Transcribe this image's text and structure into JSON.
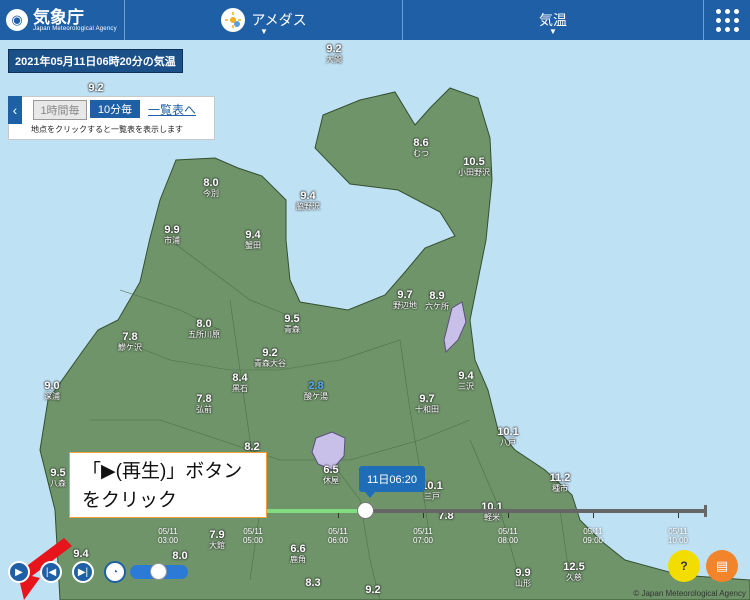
{
  "header": {
    "logo_jp": "気象庁",
    "logo_en": "Japan Meteorological Agency",
    "menu_amedas": "アメダス",
    "menu_element": "気温"
  },
  "title": "2021年05月11日06時20分の気温",
  "controls": {
    "btn_1h": "1時間毎",
    "btn_10min": "10分毎",
    "link_list": "一覧表へ",
    "note": "地点をクリックすると一覧表を表示します"
  },
  "stations": [
    {
      "value": "9.2",
      "name": "大間"
    },
    {
      "value": "8.6",
      "name": "むつ"
    },
    {
      "value": "10.5",
      "name": "小田野沢"
    },
    {
      "value": "8.0",
      "name": "今別"
    },
    {
      "value": "9.4",
      "name": "脇野沢"
    },
    {
      "value": "9.9",
      "name": "市浦"
    },
    {
      "value": "9.4",
      "name": "蟹田"
    },
    {
      "value": "9.7",
      "name": "野辺地"
    },
    {
      "value": "8.9",
      "name": "六ケ所"
    },
    {
      "value": "8.0",
      "name": "五所川原"
    },
    {
      "value": "9.5",
      "name": "青森"
    },
    {
      "value": "7.8",
      "name": "鰺ケ沢"
    },
    {
      "value": "9.2",
      "name": "青森大谷"
    },
    {
      "value": "9.0",
      "name": "深浦"
    },
    {
      "value": "8.4",
      "name": "黒石"
    },
    {
      "value": "2.8",
      "name": "酸ケ湯"
    },
    {
      "value": "9.4",
      "name": "三沢"
    },
    {
      "value": "7.8",
      "name": "弘前"
    },
    {
      "value": "9.7",
      "name": "十和田"
    },
    {
      "value": "10.1",
      "name": "八戸"
    },
    {
      "value": "6.5",
      "name": "休屋"
    },
    {
      "value": "9.5",
      "name": "八森"
    },
    {
      "value": "10.1",
      "name": "三戸"
    },
    {
      "value": "11.2",
      "name": "種市"
    },
    {
      "value": "7.8",
      "name": ""
    },
    {
      "value": "10.1",
      "name": "軽米"
    },
    {
      "value": "7.9",
      "name": "大館"
    },
    {
      "value": "9.4",
      "name": ""
    },
    {
      "value": "8.0",
      "name": ""
    },
    {
      "value": "6.6",
      "name": "鹿角"
    },
    {
      "value": "9.9",
      "name": "山形"
    },
    {
      "value": "12.5",
      "name": "久慈"
    },
    {
      "value": "8.3",
      "name": ""
    },
    {
      "value": "9.2",
      "name": ""
    },
    {
      "value": "8.2",
      "name": ""
    },
    {
      "value": "9.2",
      "name": ""
    }
  ],
  "timeline": {
    "current_label": "11日06:20",
    "ticks": [
      {
        "date": "05/11",
        "time": "03:00"
      },
      {
        "date": "05/11",
        "time": "05:00"
      },
      {
        "date": "05/11",
        "time": "06:00"
      },
      {
        "date": "05/11",
        "time": "07:00"
      },
      {
        "date": "05/11",
        "time": "08:00"
      },
      {
        "date": "05/11",
        "time": "09:00"
      },
      {
        "date": "05/11",
        "time": "10:00"
      }
    ]
  },
  "annotation": "「▶(再生)」ボタンをクリック",
  "credit": "© Japan Meteorological Agency",
  "colors": {
    "land": "#6f946a",
    "sea": "#bfe1f4",
    "header": "#1f5fa6",
    "lake": "#c9c0ea",
    "annotation_arrow": "#e8141c"
  }
}
